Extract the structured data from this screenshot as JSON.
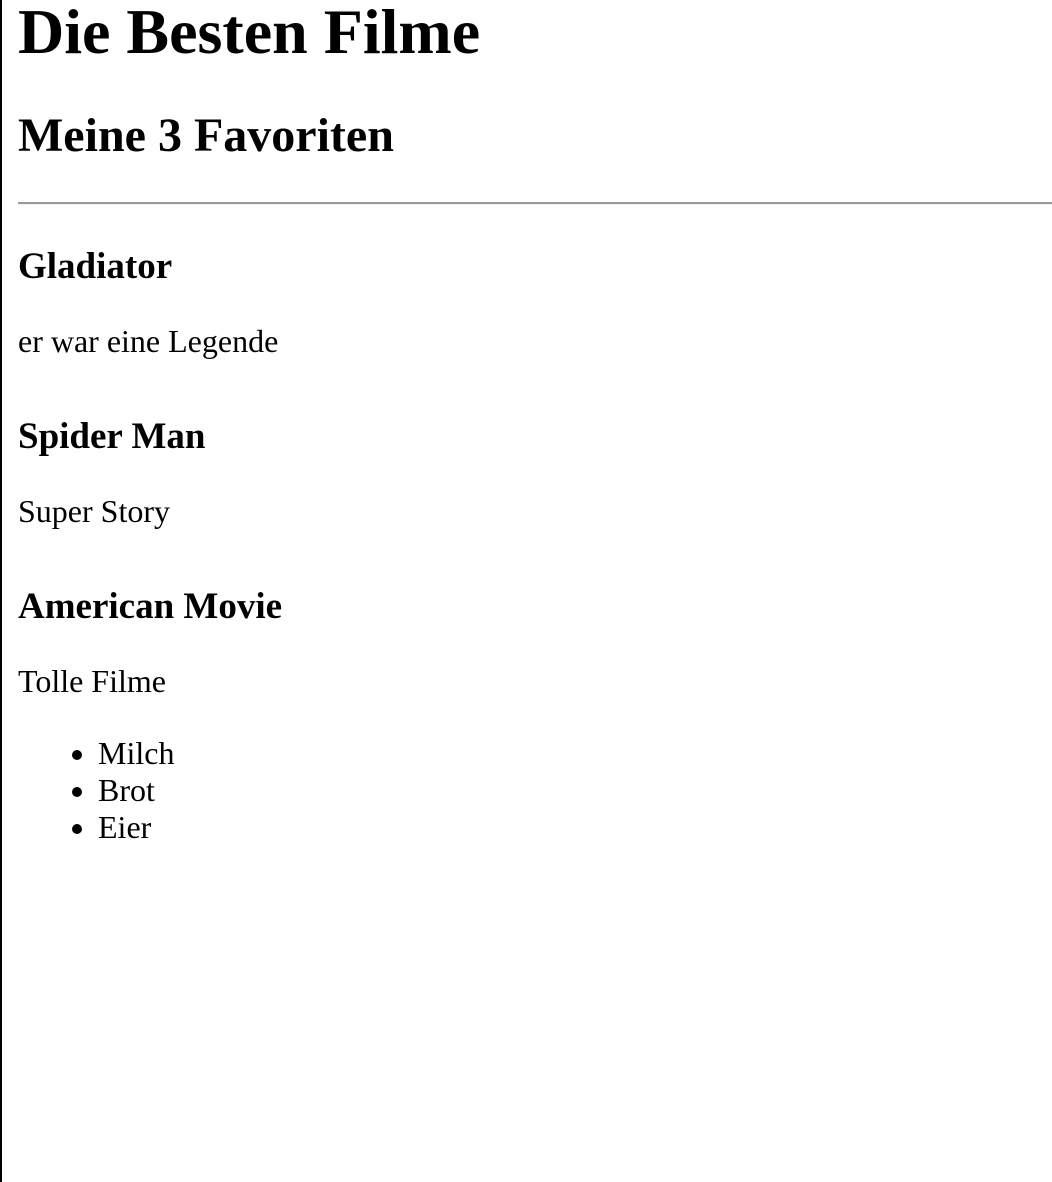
{
  "page": {
    "title": "Die Besten Filme",
    "subtitle": "Meine 3 Favoriten"
  },
  "movies": [
    {
      "title": "Gladiator",
      "description": "er war eine Legende"
    },
    {
      "title": "Spider Man",
      "description": "Super Story"
    },
    {
      "title": "American Movie",
      "description": "Tolle Filme"
    }
  ],
  "list": {
    "items": [
      "Milch",
      "Brot",
      "Eier"
    ]
  }
}
